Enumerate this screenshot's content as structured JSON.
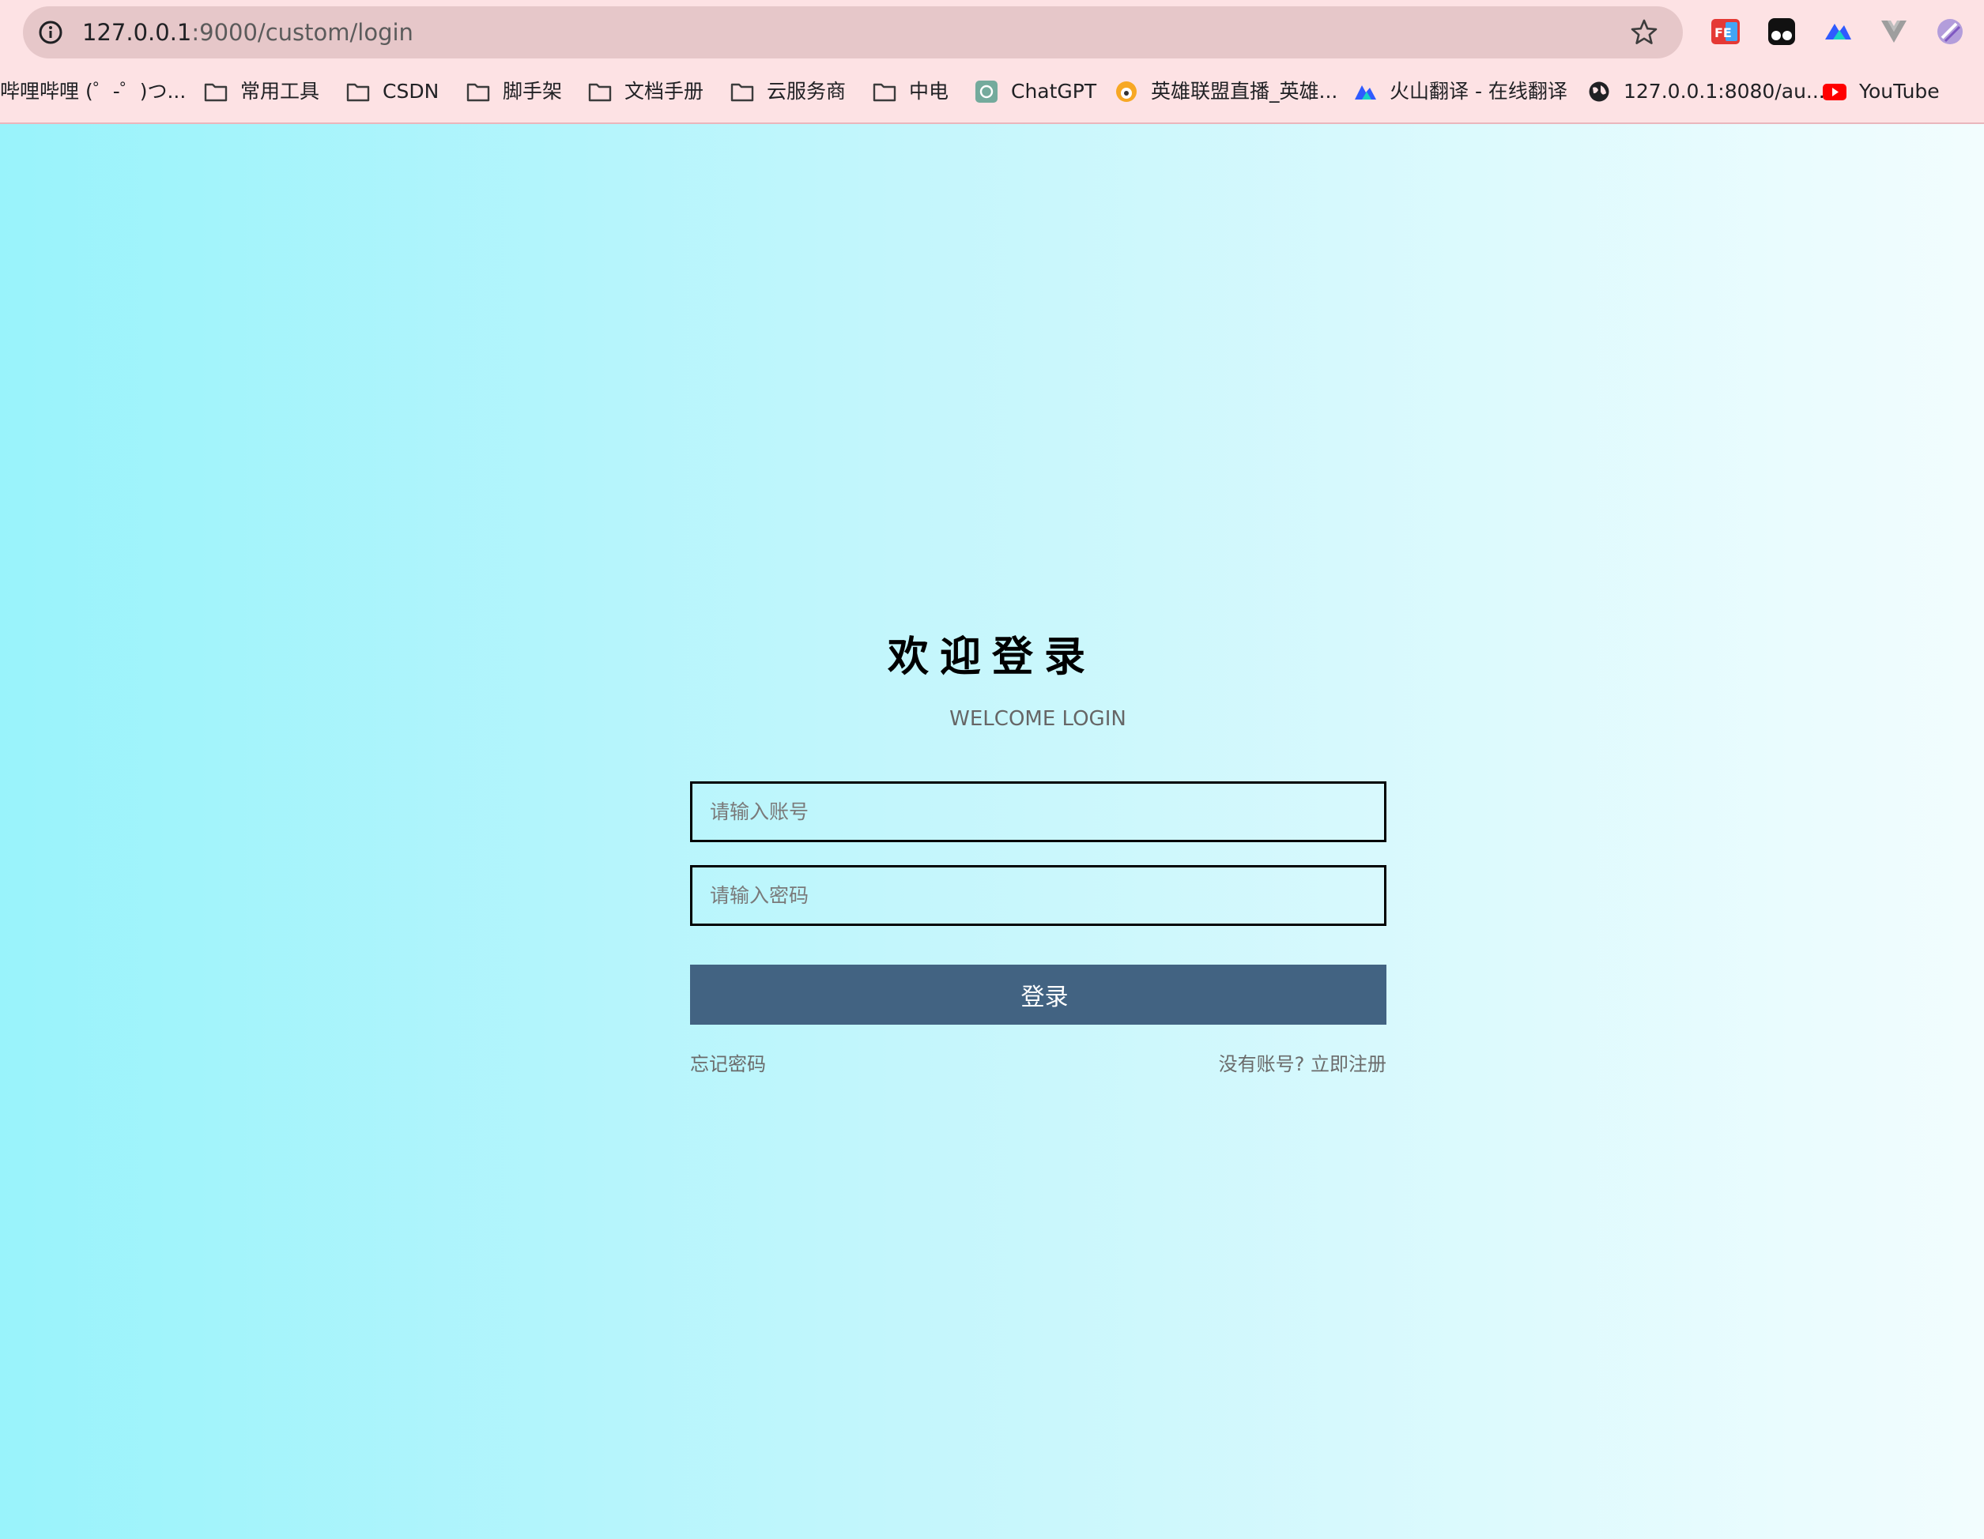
{
  "browser": {
    "url_host": "127.0.0.1",
    "url_rest": ":9000/custom/login",
    "bookmarks": [
      {
        "label": "哔哩哔哩 (゜-゜)つ...",
        "icon": "none"
      },
      {
        "label": "常用工具",
        "icon": "folder-icon"
      },
      {
        "label": "CSDN",
        "icon": "folder-icon"
      },
      {
        "label": "脚手架",
        "icon": "folder-icon"
      },
      {
        "label": "文档手册",
        "icon": "folder-icon"
      },
      {
        "label": "云服务商",
        "icon": "folder-icon"
      },
      {
        "label": "中电",
        "icon": "folder-icon"
      },
      {
        "label": "ChatGPT",
        "icon": "chatgpt-icon"
      },
      {
        "label": "英雄联盟直播_英雄...",
        "icon": "huya-icon"
      },
      {
        "label": "火山翻译 - 在线翻译",
        "icon": "volcano-icon"
      },
      {
        "label": "127.0.0.1:8080/au...",
        "icon": "globe-icon"
      },
      {
        "label": "YouTube",
        "icon": "youtube-icon"
      }
    ],
    "extensions": [
      "fe-helper-icon",
      "tampermonkey-icon",
      "volcano-translate-icon",
      "vue-devtools-icon",
      "extension-icon"
    ]
  },
  "login": {
    "title": "欢迎登录",
    "subtitle": "WELCOME LOGIN",
    "account_placeholder": "请输入账号",
    "password_placeholder": "请输入密码",
    "submit_label": "登录",
    "forgot_label": "忘记密码",
    "register_label": "没有账号? 立即注册"
  },
  "colors": {
    "chrome_bg": "#fde2e4",
    "button_bg": "#426382",
    "gradient_start": "#99f3fb",
    "gradient_end": "#f2fdfe"
  }
}
